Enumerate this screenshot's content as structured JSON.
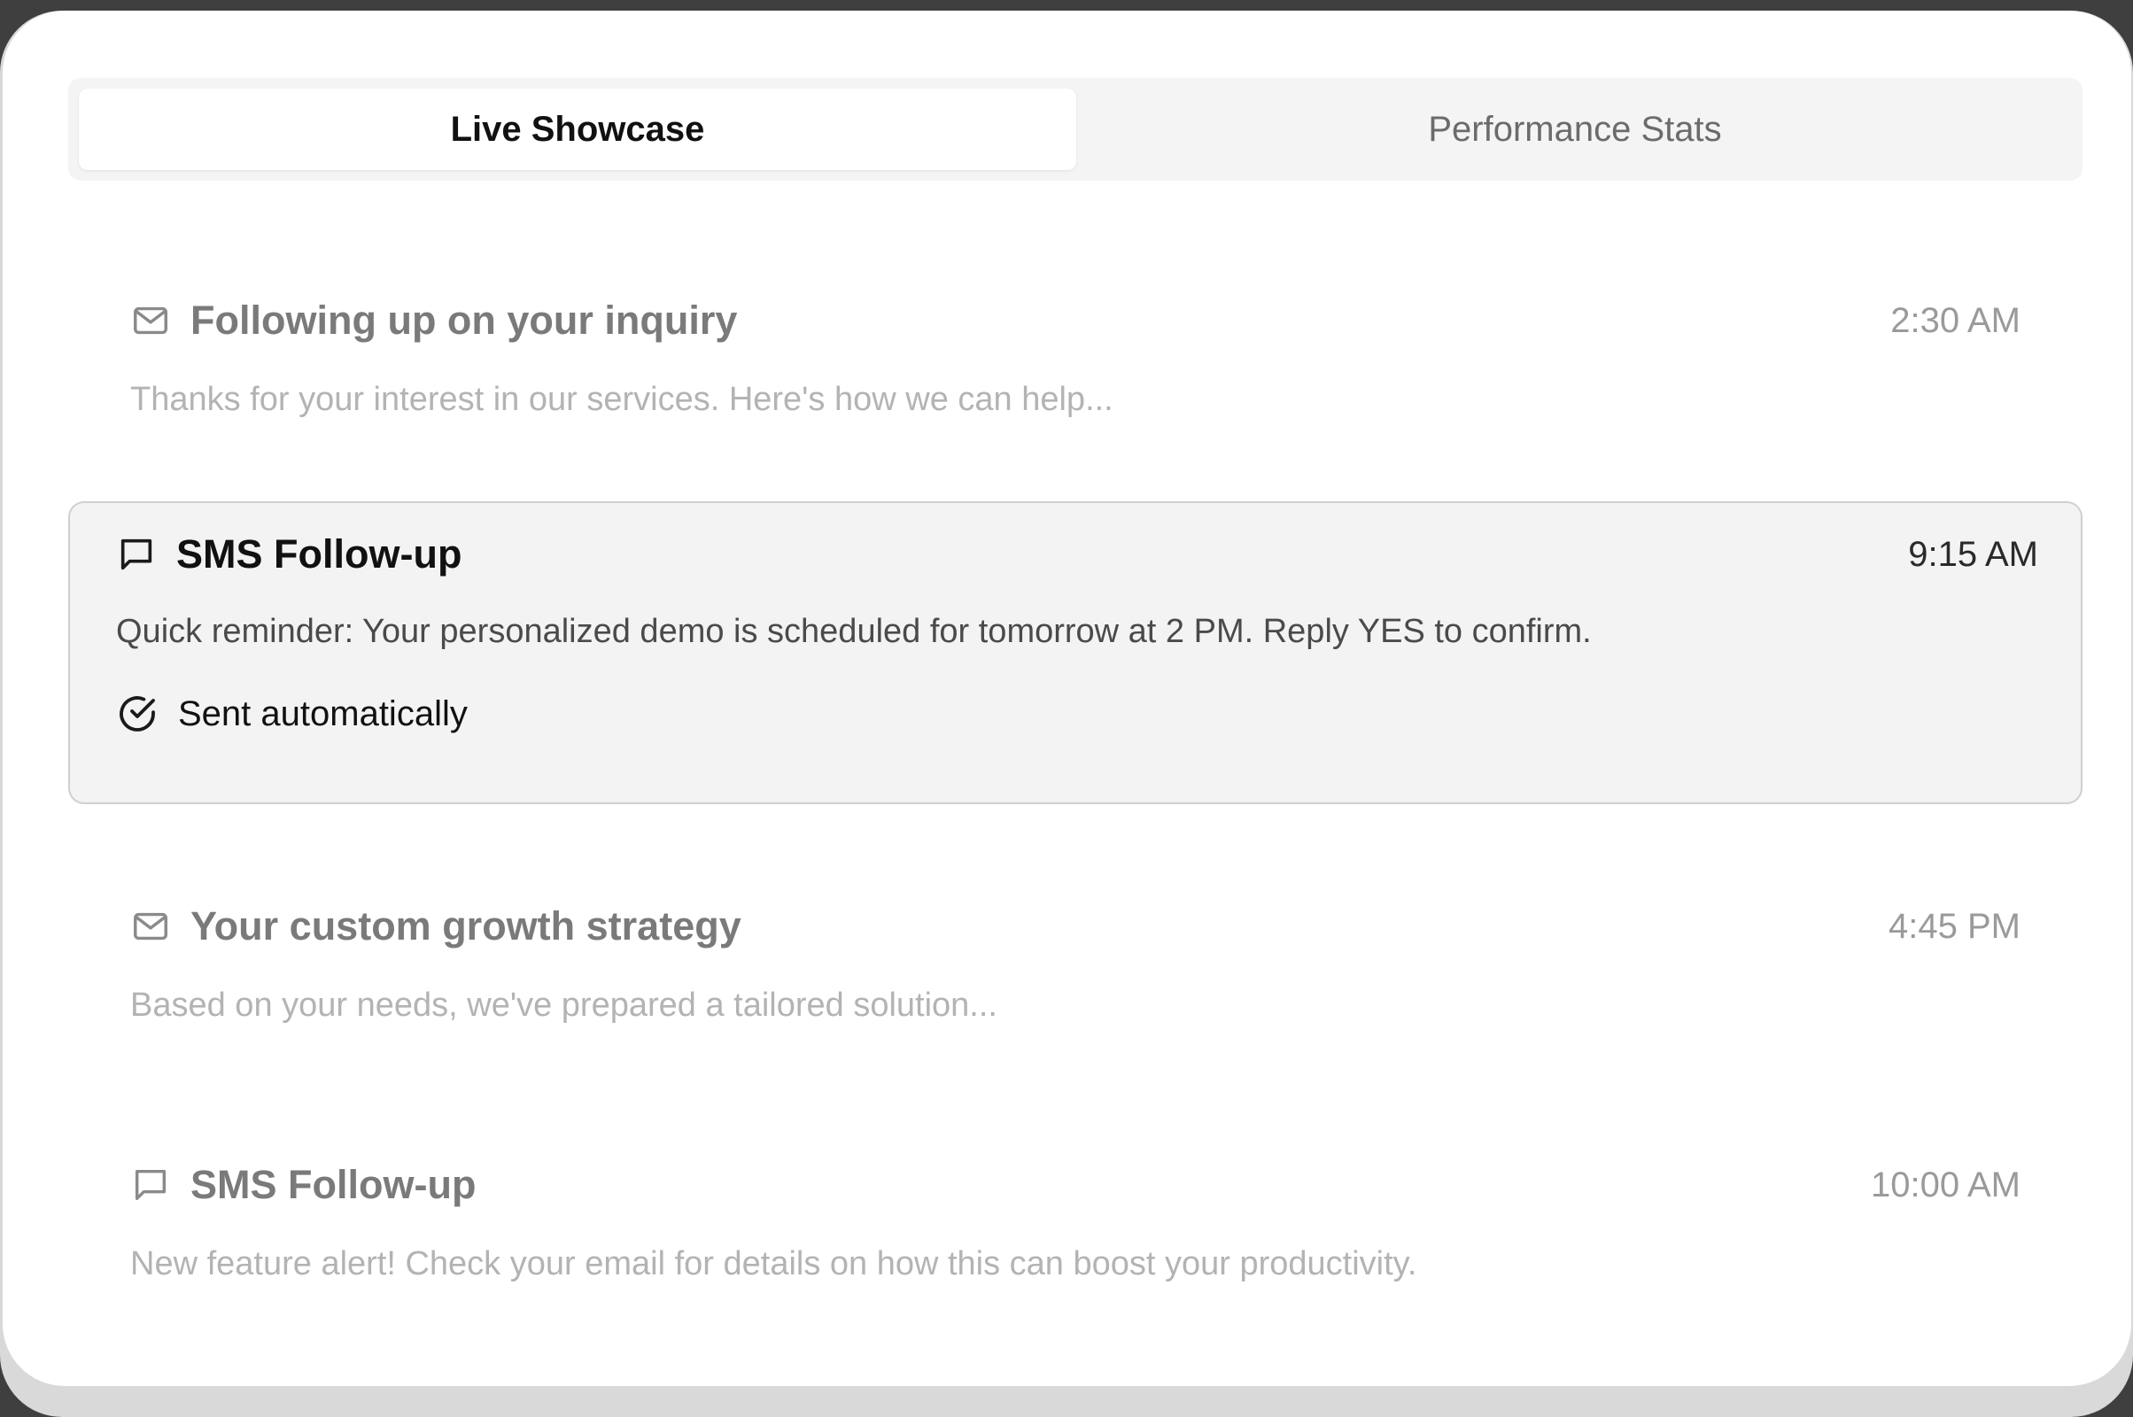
{
  "tabs": [
    {
      "label": "Live Showcase",
      "active": true
    },
    {
      "label": "Performance Stats",
      "active": false
    }
  ],
  "messages": [
    {
      "icon": "mail-icon",
      "title": "Following up on your inquiry",
      "time": "2:30 AM",
      "body": "Thanks for your interest in our services. Here's how we can help..."
    },
    {
      "icon": "message-icon",
      "title": "SMS Follow-up",
      "time": "9:15 AM",
      "body": "Quick reminder: Your personalized demo is scheduled for tomorrow at 2 PM. Reply YES to confirm.",
      "status": "Sent automatically",
      "status_icon": "check-circle-icon"
    },
    {
      "icon": "mail-icon",
      "title": "Your custom growth strategy",
      "time": "4:45 PM",
      "body": "Based on your needs, we've prepared a tailored solution..."
    },
    {
      "icon": "message-icon",
      "title": "SMS Follow-up",
      "time": "10:00 AM",
      "body": "New feature alert! Check your email for details on how this can boost your productivity."
    }
  ]
}
